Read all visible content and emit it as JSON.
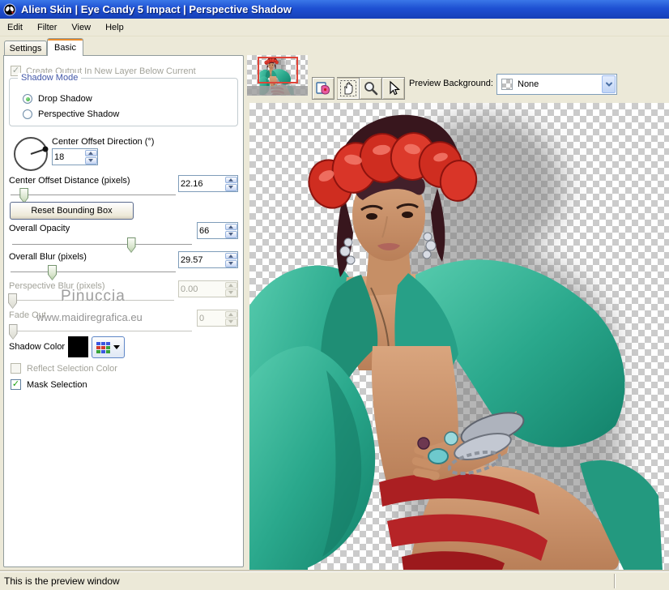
{
  "window": {
    "title": "Alien Skin | Eye Candy 5 Impact | Perspective Shadow"
  },
  "menu": {
    "items": [
      "Edit",
      "Filter",
      "View",
      "Help"
    ]
  },
  "tabs": {
    "settings": "Settings",
    "basic": "Basic",
    "active": "Basic"
  },
  "panel": {
    "create_output": {
      "label": "Create Output In New Layer Below Current",
      "checked": true,
      "disabled": true
    },
    "shadow_mode": {
      "title": "Shadow Mode",
      "drop": "Drop Shadow",
      "perspective": "Perspective Shadow",
      "selected": "Drop Shadow"
    },
    "direction": {
      "label": "Center Offset Direction (°)",
      "value": "18"
    },
    "distance": {
      "label": "Center Offset Distance (pixels)",
      "value": "22.16",
      "slider_left": "8%"
    },
    "reset_button": {
      "label": "Reset Bounding Box"
    },
    "opacity": {
      "label": "Overall Opacity",
      "value": "66",
      "slider_left": "66%"
    },
    "blur": {
      "label": "Overall Blur (pixels)",
      "value": "29.57",
      "slider_left": "25%"
    },
    "perspective_blur": {
      "label": "Perspective Blur (pixels)",
      "value": "0.00",
      "slider_left": "2%",
      "disabled": true
    },
    "fade_out": {
      "label": "Fade Out",
      "value": "0",
      "slider_left": "2%",
      "disabled": true
    },
    "shadow_color": {
      "label": "Shadow Color",
      "color": "#000000"
    },
    "reflect": {
      "label": "Reflect Selection Color",
      "checked": false,
      "disabled": true
    },
    "mask": {
      "label": "Mask Selection",
      "checked": true
    },
    "check_glyph": "✓"
  },
  "watermark": {
    "name": "Pinuccia",
    "url": "www.maidiregrafica.eu"
  },
  "preview_bar": {
    "background_label": "Preview Background:",
    "background_value": "None"
  },
  "status": {
    "text": "This is the preview window"
  },
  "palette": {
    "titlebar_blue": "#1e50d2",
    "window_beige": "#ece9d8",
    "checker_gray": "#cbcbcb",
    "jacket_teal": "#2aa88c",
    "headband_red": "#cf2d20",
    "bikini_red": "#b02124",
    "shadow_gray": "#6f6f6f",
    "nav_rect_red": "#e04438",
    "tab_accent_orange": "#e68b2c"
  }
}
